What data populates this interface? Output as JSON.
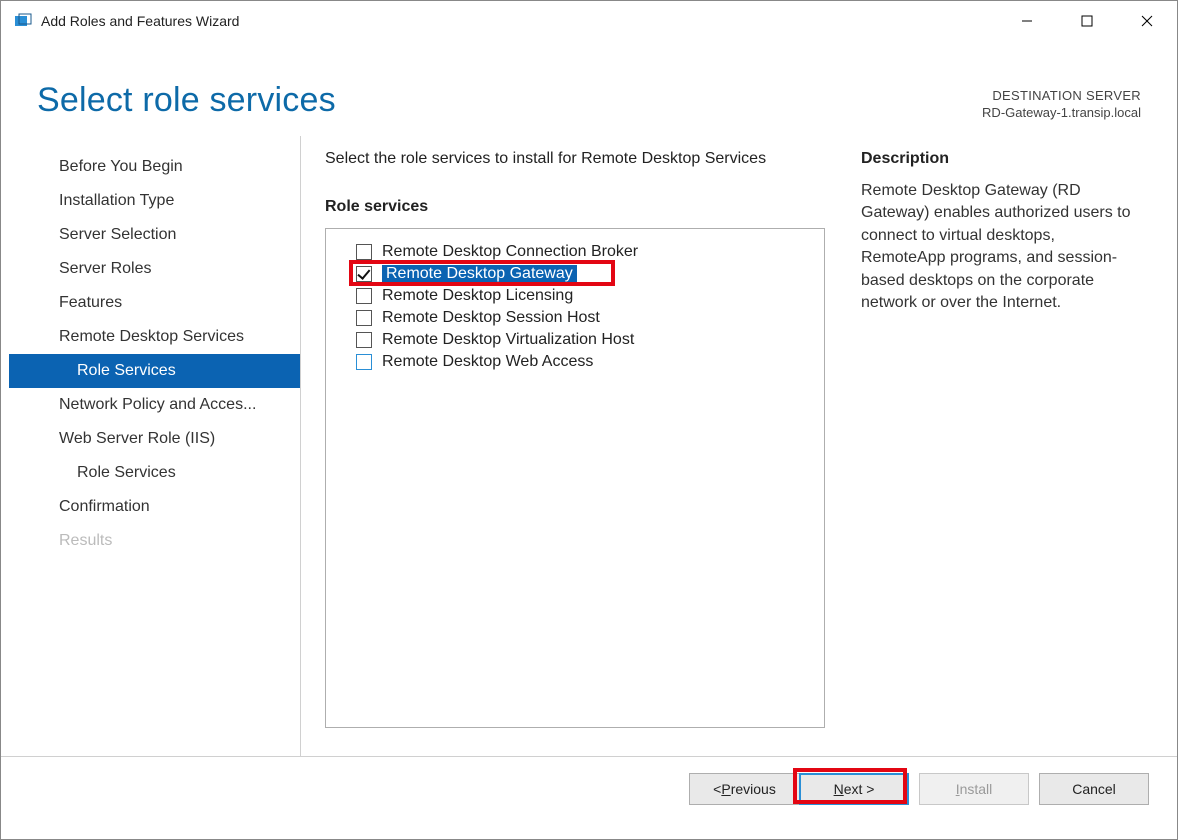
{
  "window": {
    "title": "Add Roles and Features Wizard"
  },
  "page": {
    "title": "Select role services",
    "destination_label": "DESTINATION SERVER",
    "destination_value": "RD-Gateway-1.transip.local",
    "instruction": "Select the role services to install for Remote Desktop Services",
    "role_services_label": "Role services",
    "description_label": "Description",
    "description_text": "Remote Desktop Gateway (RD Gateway) enables authorized users to connect to virtual desktops, RemoteApp programs, and session-based desktops on the corporate network or over the Internet."
  },
  "sidebar": {
    "items": [
      {
        "label": "Before You Begin",
        "indent": false,
        "active": false,
        "disabled": false
      },
      {
        "label": "Installation Type",
        "indent": false,
        "active": false,
        "disabled": false
      },
      {
        "label": "Server Selection",
        "indent": false,
        "active": false,
        "disabled": false
      },
      {
        "label": "Server Roles",
        "indent": false,
        "active": false,
        "disabled": false
      },
      {
        "label": "Features",
        "indent": false,
        "active": false,
        "disabled": false
      },
      {
        "label": "Remote Desktop Services",
        "indent": false,
        "active": false,
        "disabled": false
      },
      {
        "label": "Role Services",
        "indent": true,
        "active": true,
        "disabled": false
      },
      {
        "label": "Network Policy and Acces...",
        "indent": false,
        "active": false,
        "disabled": false
      },
      {
        "label": "Web Server Role (IIS)",
        "indent": false,
        "active": false,
        "disabled": false
      },
      {
        "label": "Role Services",
        "indent": true,
        "active": false,
        "disabled": false
      },
      {
        "label": "Confirmation",
        "indent": false,
        "active": false,
        "disabled": false
      },
      {
        "label": "Results",
        "indent": false,
        "active": false,
        "disabled": true
      }
    ]
  },
  "role_services": [
    {
      "label": "Remote Desktop Connection Broker",
      "checked": false,
      "selected": false,
      "focus": false
    },
    {
      "label": "Remote Desktop Gateway",
      "checked": true,
      "selected": true,
      "focus": false
    },
    {
      "label": "Remote Desktop Licensing",
      "checked": false,
      "selected": false,
      "focus": false
    },
    {
      "label": "Remote Desktop Session Host",
      "checked": false,
      "selected": false,
      "focus": false
    },
    {
      "label": "Remote Desktop Virtualization Host",
      "checked": false,
      "selected": false,
      "focus": false
    },
    {
      "label": "Remote Desktop Web Access",
      "checked": false,
      "selected": false,
      "focus": true
    }
  ],
  "buttons": {
    "previous": "Previous",
    "previous_access": "P",
    "next": "Next >",
    "next_access": "N",
    "install": "Install",
    "install_access": "I",
    "cancel": "Cancel"
  }
}
